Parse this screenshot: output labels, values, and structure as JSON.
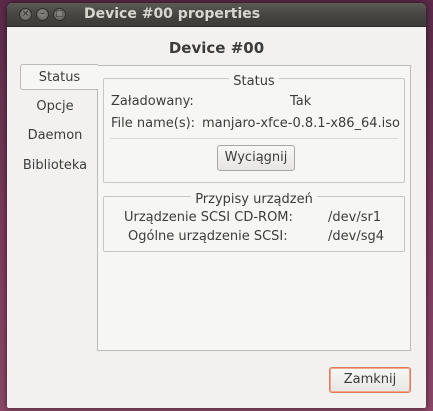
{
  "window": {
    "title": "Device #00 properties"
  },
  "heading": "Device #00",
  "tabs": [
    {
      "label": "Status"
    },
    {
      "label": "Opcje"
    },
    {
      "label": "Daemon"
    },
    {
      "label": "Biblioteka"
    }
  ],
  "status_frame": {
    "title": "Status",
    "rows": [
      {
        "label": "Załadowany:",
        "value": "Tak"
      },
      {
        "label": "File name(s):",
        "value": "manjaro-xfce-0.8.1-x86_64.iso"
      }
    ],
    "eject_button": "Wyciągnij"
  },
  "devices_frame": {
    "title": "Przypisy urządzeń",
    "rows": [
      {
        "label": "Urządzenie SCSI CD-ROM:",
        "value": "/dev/sr1"
      },
      {
        "label": "Ogólne urządzenie SCSI:",
        "value": "/dev/sg4"
      }
    ]
  },
  "close_button": "Zamknij"
}
